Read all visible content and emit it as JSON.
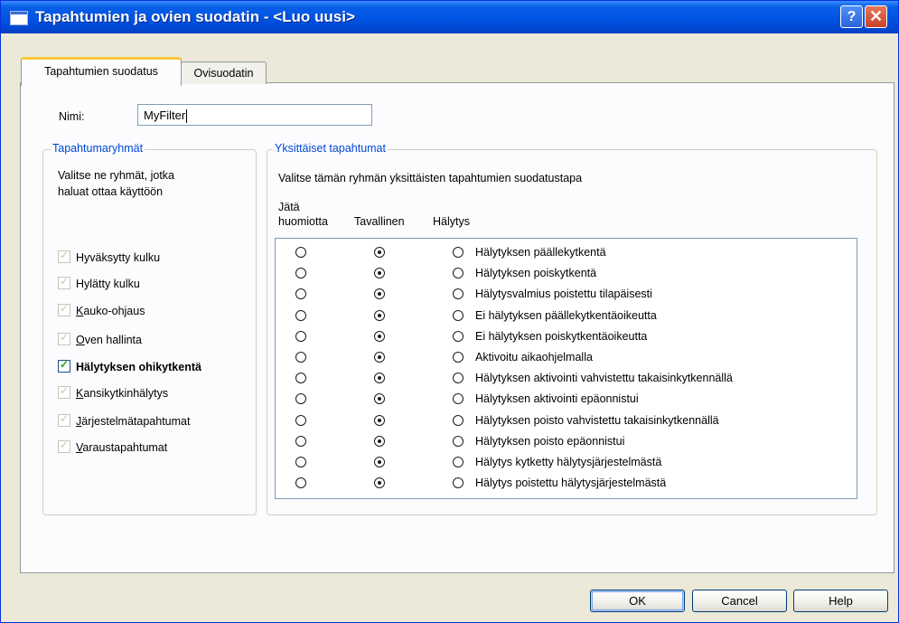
{
  "window": {
    "title": "Tapahtumien ja ovien suodatin - <Luo uusi>",
    "help_button": "?",
    "close_button": "✕"
  },
  "tabs": [
    {
      "label": "Tapahtumien suodatus",
      "active": true
    },
    {
      "label": "Ovisuodatin",
      "active": false
    }
  ],
  "name_field": {
    "label": "Nimi:",
    "value": "MyFilter"
  },
  "groups": {
    "title": "Tapahtumaryhmät",
    "description_line1": "Valitse ne ryhmät, jotka",
    "description_line2": "haluat ottaa käyttöön",
    "items": [
      {
        "label": "Hyväksytty kulku",
        "checked": true,
        "enabled": false
      },
      {
        "label": "Hylätty kulku",
        "checked": true,
        "enabled": false
      },
      {
        "label": "Kauko-ohjaus",
        "checked": true,
        "enabled": false
      },
      {
        "label": "Oven hallinta",
        "checked": true,
        "enabled": false
      },
      {
        "label": "Hälytyksen ohikytkentä",
        "checked": true,
        "enabled": true
      },
      {
        "label": "Kansikytkinhälytys",
        "checked": true,
        "enabled": false
      },
      {
        "label": "Järjestelmätapahtumat",
        "checked": true,
        "enabled": false
      },
      {
        "label": "Varaustapahtumat",
        "checked": true,
        "enabled": false
      }
    ]
  },
  "events": {
    "title": "Yksittäiset tapahtumat",
    "description": "Valitse tämän ryhmän yksittäisten tapahtumien suodatustapa",
    "col_ignore_line1": "Jätä",
    "col_ignore_line2": "huomiotta",
    "col_normal": "Tavallinen",
    "col_alarm": "Hälytys",
    "items": [
      {
        "label": "Hälytyksen päällekytkentä",
        "selected": "normal"
      },
      {
        "label": "Hälytyksen poiskytkentä",
        "selected": "normal"
      },
      {
        "label": "Hälytysvalmius poistettu tilapäisesti",
        "selected": "normal"
      },
      {
        "label": "Ei hälytyksen päällekytkentäoikeutta",
        "selected": "normal"
      },
      {
        "label": "Ei hälytyksen poiskytkentäoikeutta",
        "selected": "normal"
      },
      {
        "label": "Aktivoitu aikaohjelmalla",
        "selected": "normal"
      },
      {
        "label": "Hälytyksen aktivointi vahvistettu takaisinkytkennällä",
        "selected": "normal"
      },
      {
        "label": "Hälytyksen aktivointi epäonnistui",
        "selected": "normal"
      },
      {
        "label": "Hälytyksen poisto vahvistettu takaisinkytkennällä",
        "selected": "normal"
      },
      {
        "label": "Hälytyksen poisto epäonnistui",
        "selected": "normal"
      },
      {
        "label": "Hälytys kytketty hälytysjärjestelmästä",
        "selected": "normal"
      },
      {
        "label": "Hälytys poistettu hälytysjärjestelmästä",
        "selected": "normal"
      }
    ]
  },
  "buttons": {
    "ok": "OK",
    "cancel": "Cancel",
    "help": "Help"
  },
  "colors": {
    "titlebar": "#0055e5",
    "legend_text": "#0046d5",
    "active_tab_highlight": "#ffc83c",
    "check_green": "#21a121"
  }
}
